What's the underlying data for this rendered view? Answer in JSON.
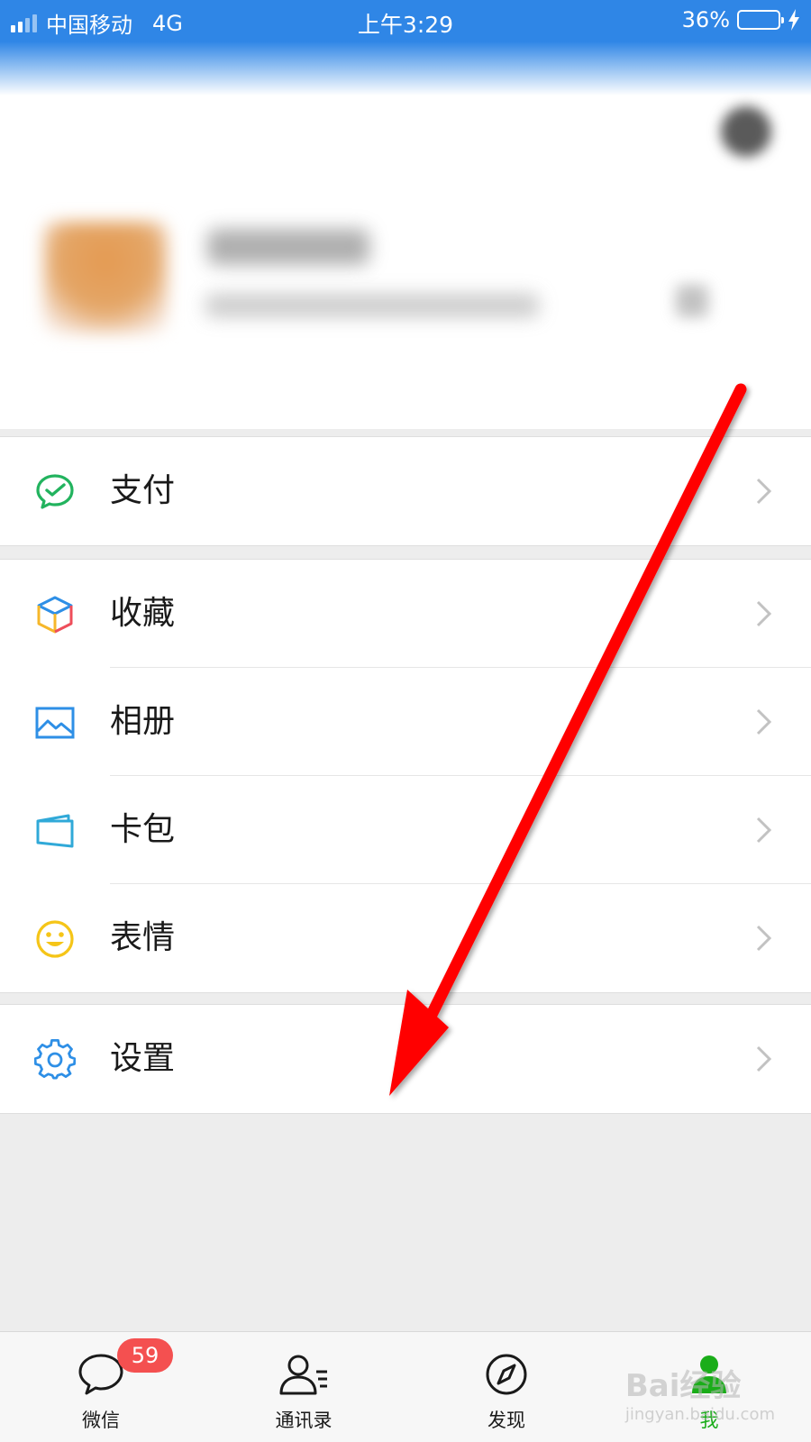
{
  "status_bar": {
    "carrier": "中国移动",
    "network": "4G",
    "time": "上午3:29",
    "battery_percent_label": "36%",
    "battery_level": 0.36,
    "color": "#2f86e6"
  },
  "menu": {
    "groups": [
      {
        "items": [
          {
            "label": "支付",
            "icon": "wechat-pay-icon"
          }
        ]
      },
      {
        "items": [
          {
            "label": "收藏",
            "icon": "favorites-cube-icon"
          },
          {
            "label": "相册",
            "icon": "album-photo-icon"
          },
          {
            "label": "卡包",
            "icon": "card-wallet-icon"
          },
          {
            "label": "表情",
            "icon": "smiley-face-icon"
          }
        ]
      },
      {
        "items": [
          {
            "label": "设置",
            "icon": "gear-icon"
          }
        ]
      }
    ]
  },
  "tabbar": {
    "tabs": [
      {
        "label": "微信",
        "icon": "chat-bubble-icon",
        "badge": "59"
      },
      {
        "label": "通讯录",
        "icon": "contacts-icon"
      },
      {
        "label": "发现",
        "icon": "compass-icon"
      },
      {
        "label": "我",
        "icon": "profile-me-icon",
        "active": true
      }
    ],
    "active_color": "#1aad19"
  },
  "annotation": {
    "arrow_color": "#ff0000"
  },
  "watermark": {
    "brand": "Bai经验",
    "url": "jingyan.baidu.com"
  }
}
